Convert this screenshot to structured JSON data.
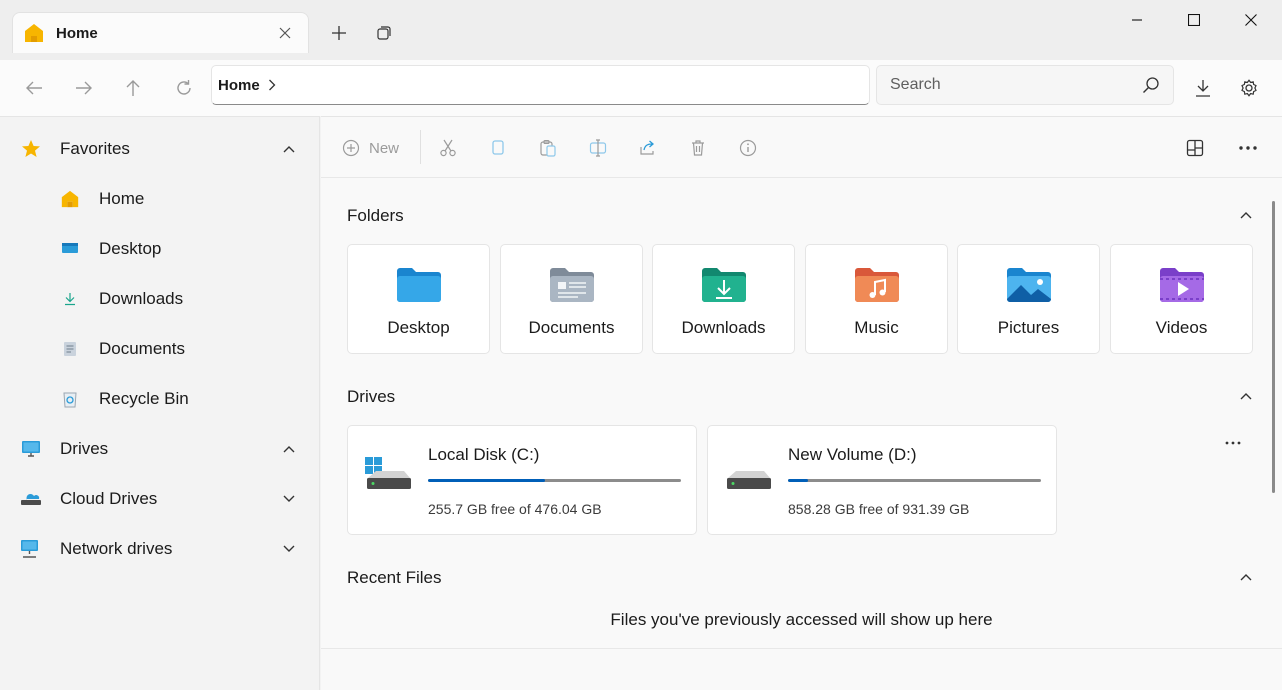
{
  "colors": {
    "accent": "#005fb8",
    "folder_yellow": "#f7b500"
  },
  "tab": {
    "title": "Home",
    "icon": "home-icon"
  },
  "address": {
    "crumb": "Home"
  },
  "search": {
    "placeholder": "Search"
  },
  "sidebar": {
    "favorites": {
      "label": "Favorites",
      "icon": "star-icon",
      "expanded": true
    },
    "items": [
      {
        "label": "Home",
        "icon": "home-icon"
      },
      {
        "label": "Desktop",
        "icon": "desktop-icon"
      },
      {
        "label": "Downloads",
        "icon": "download-icon"
      },
      {
        "label": "Documents",
        "icon": "documents-icon"
      },
      {
        "label": "Recycle Bin",
        "icon": "recycle-bin-icon"
      }
    ],
    "drives": {
      "label": "Drives",
      "icon": "monitor-icon",
      "expanded": true
    },
    "cloud": {
      "label": "Cloud Drives",
      "icon": "cloud-drive-icon",
      "expanded": false
    },
    "network": {
      "label": "Network drives",
      "icon": "network-icon",
      "expanded": false
    }
  },
  "toolbar": {
    "new_label": "New"
  },
  "sections": {
    "folders": "Folders",
    "drives": "Drives",
    "recent": "Recent Files"
  },
  "folders": [
    {
      "label": "Desktop",
      "icon": "desktop-folder-icon"
    },
    {
      "label": "Documents",
      "icon": "documents-folder-icon"
    },
    {
      "label": "Downloads",
      "icon": "downloads-folder-icon"
    },
    {
      "label": "Music",
      "icon": "music-folder-icon"
    },
    {
      "label": "Pictures",
      "icon": "pictures-folder-icon"
    },
    {
      "label": "Videos",
      "icon": "videos-folder-icon"
    }
  ],
  "drives": [
    {
      "name": "Local Disk (C:)",
      "free_text": "255.7 GB free of 476.04 GB",
      "used_fraction": 0.463
    },
    {
      "name": "New Volume (D:)",
      "free_text": "858.28 GB free of 931.39 GB",
      "used_fraction": 0.079
    }
  ],
  "recent": {
    "empty_text": "Files you've previously accessed will show up here"
  }
}
